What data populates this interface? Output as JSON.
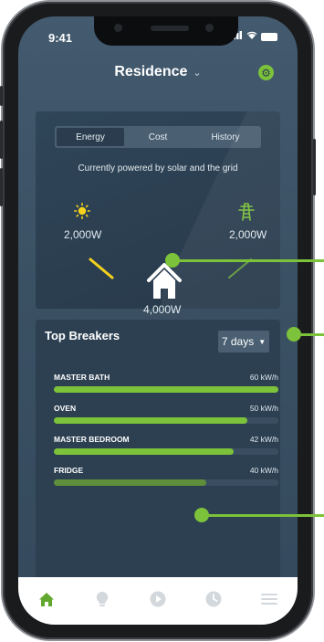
{
  "status_bar": {
    "time": "9:41"
  },
  "header": {
    "title": "Residence",
    "chevron_icon": "chevron-down-icon",
    "settings_icon": "gear-icon"
  },
  "energy": {
    "tabs": [
      {
        "label": "Energy",
        "active": true
      },
      {
        "label": "Cost",
        "active": false
      },
      {
        "label": "History",
        "active": false
      }
    ],
    "subtitle": "Currently powered by solar and the grid",
    "solar": {
      "icon": "sun-icon",
      "value": "2,000W"
    },
    "grid": {
      "icon": "power-tower-icon",
      "value": "2,000W"
    },
    "home": {
      "icon": "house-icon",
      "value": "4,000W"
    }
  },
  "breakers": {
    "title": "Top Breakers",
    "range_label": "7 days",
    "items": [
      {
        "name": "MASTER BATH",
        "amount": "60 kW/h",
        "fraction": 1.0
      },
      {
        "name": "OVEN",
        "amount": "50 kW/h",
        "fraction": 0.86
      },
      {
        "name": "MASTER BEDROOM",
        "amount": "42 kW/h",
        "fraction": 0.8
      },
      {
        "name": "FRIDGE",
        "amount": "40 kW/h",
        "fraction": 0.68
      }
    ]
  },
  "tabbar": {
    "items": [
      {
        "icon": "home-icon",
        "active": true
      },
      {
        "icon": "lightbulb-icon",
        "active": false
      },
      {
        "icon": "play-icon",
        "active": false
      },
      {
        "icon": "clock-icon",
        "active": false
      },
      {
        "icon": "menu-icon",
        "active": false
      }
    ]
  },
  "colors": {
    "accent": "#7cc23a",
    "background": "#3a5063",
    "card": "#2c4052"
  }
}
